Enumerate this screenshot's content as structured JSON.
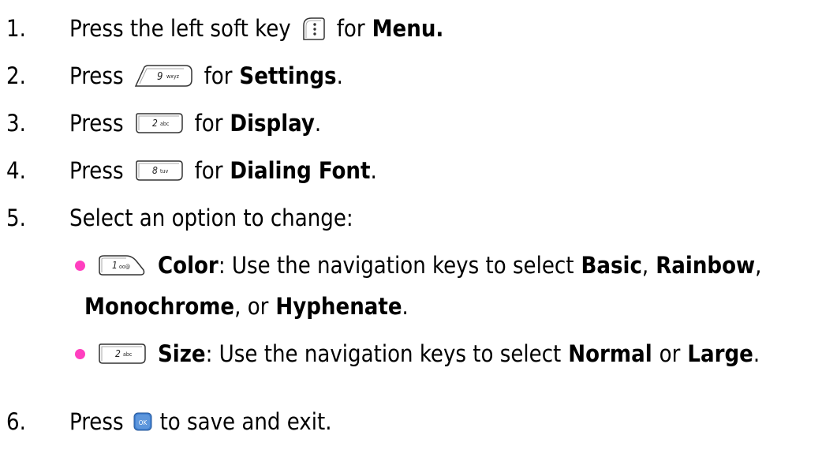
{
  "steps": [
    {
      "num": "1.",
      "pre": "Press the left soft key",
      "key_icon": "left-soft-key-menu-icon",
      "mid": "for",
      "bold": "Menu.",
      "post": ""
    },
    {
      "num": "2.",
      "pre": "Press",
      "key_icon": "key-9-wxyz-icon",
      "key_label": "9",
      "key_sub": "wxyz",
      "mid": "for",
      "bold": "Settings",
      "post": "."
    },
    {
      "num": "3.",
      "pre": "Press",
      "key_icon": "key-2-abc-icon",
      "key_label": "2",
      "key_sub": "abc",
      "mid": "for",
      "bold": "Display",
      "post": "."
    },
    {
      "num": "4.",
      "pre": "Press",
      "key_icon": "key-8-tuv-icon",
      "key_label": "8",
      "key_sub": "tuv",
      "mid": "for",
      "bold": "Dialing Font",
      "post": "."
    },
    {
      "num": "5.",
      "text": "Select an option to change:"
    },
    {
      "num": "6.",
      "pre": "Press",
      "key_icon": "ok-key-icon",
      "key_label": "OK",
      "post": "to save and exit."
    }
  ],
  "options": [
    {
      "key_icon": "key-1-voicemail-icon",
      "key_label": "1",
      "key_sub": "oo@",
      "label": "Color",
      "desc": ": Use the navigation keys to select",
      "choices": [
        "Basic",
        "Rainbow",
        "Monochrome",
        "Hyphenate"
      ],
      "sep1": ",",
      "sep2": ",",
      "sep3": ", or",
      "end": "."
    },
    {
      "key_icon": "key-2-abc-icon",
      "key_label": "2",
      "key_sub": "abc",
      "label": "Size",
      "desc": ": Use the navigation keys to select",
      "choices": [
        "Normal",
        "Large"
      ],
      "sep1": "or",
      "end": "."
    }
  ],
  "colors": {
    "bullet": "#ff3fbf",
    "text": "#000000",
    "ok_key": "#3f7fd0"
  }
}
